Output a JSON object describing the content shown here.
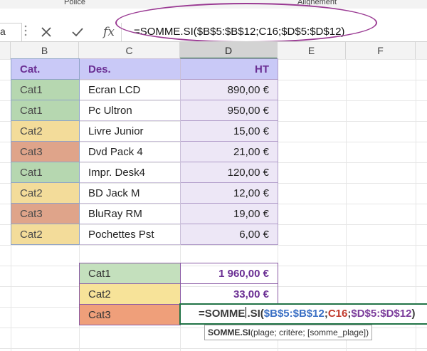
{
  "ribbon": {
    "group_police": "Police",
    "group_alignement": "Alignement"
  },
  "formula_bar": {
    "namebox_fragment": "a",
    "cancel_icon": "close-x-icon",
    "enter_icon": "checkmark-icon",
    "fx_label": "fx",
    "formula": "=SOMME.SI($B$5:$B$12;C16;$D$5:$D$12)"
  },
  "columns": [
    "B",
    "C",
    "D",
    "E",
    "F"
  ],
  "selected_column": "D",
  "table": {
    "headers": {
      "cat": "Cat.",
      "des": "Des.",
      "ht": "HT"
    },
    "rows": [
      {
        "cat": "Cat1",
        "des": "Ecran LCD",
        "ht": "890,00 €"
      },
      {
        "cat": "Cat1",
        "des": "Pc Ultron",
        "ht": "950,00 €"
      },
      {
        "cat": "Cat2",
        "des": "Livre Junior",
        "ht": "15,00 €"
      },
      {
        "cat": "Cat3",
        "des": "Dvd Pack 4",
        "ht": "21,00 €"
      },
      {
        "cat": "Cat1",
        "des": "Impr. Desk4",
        "ht": "120,00 €"
      },
      {
        "cat": "Cat2",
        "des": "BD Jack M",
        "ht": "12,00 €"
      },
      {
        "cat": "Cat3",
        "des": "BluRay RM",
        "ht": "19,00 €"
      },
      {
        "cat": "Cat2",
        "des": "Pochettes Pst",
        "ht": "6,00 €"
      }
    ]
  },
  "summary": [
    {
      "cat": "Cat1",
      "total": "1 960,00 €"
    },
    {
      "cat": "Cat2",
      "total": "33,00 €"
    },
    {
      "cat": "Cat3",
      "total": ""
    }
  ],
  "edit_cell": {
    "part1": "=SOMME",
    "part2": ".SI(",
    "range1": "$B$5:$B$12",
    "sep1": ";",
    "criteria": "C16",
    "sep2": ";",
    "range2": "$D$5:$D$12",
    "close": ")"
  },
  "tooltip": {
    "func": "SOMME.SI",
    "args": "(plage; critère; [somme_plage])"
  },
  "colors": {
    "cat1": "#b6d7b0",
    "cat2": "#f3dc9a",
    "cat3": "#dfa48a",
    "header": "#c9c9f7",
    "accent_purple": "#6a2e93",
    "selection_green": "#217346"
  }
}
